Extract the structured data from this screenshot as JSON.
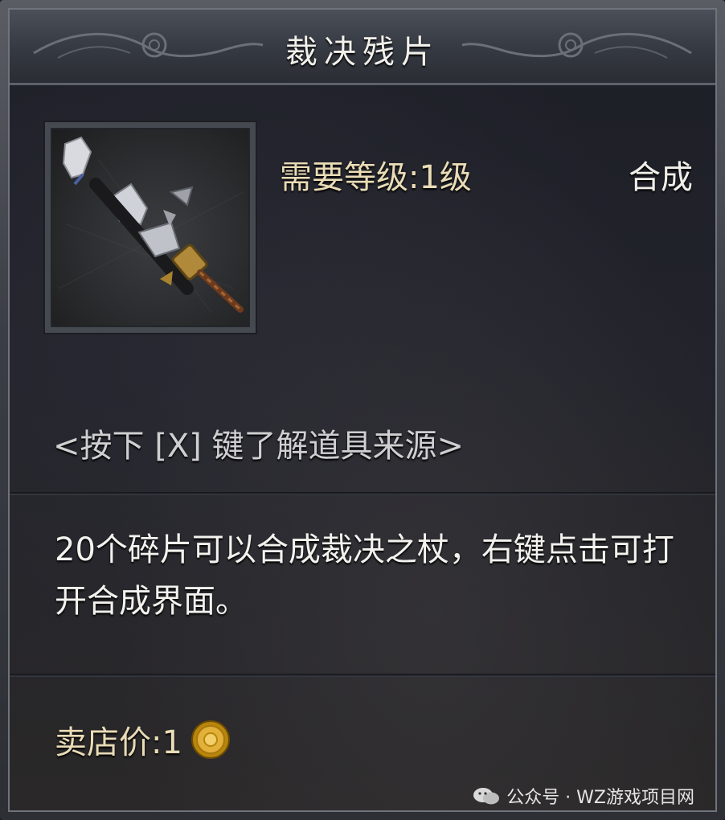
{
  "tooltip": {
    "title": "裁决残片",
    "required_level": "需要等级:1级",
    "item_type": "合成",
    "source_hint": "<按下 [X] 键了解道具来源>",
    "description": "20个碎片可以合成裁决之杖，右键点击可打开合成界面。",
    "sell_price": "卖店价:1",
    "icons": {
      "item": "sword-fragment-icon",
      "currency": "gold-coin-icon"
    }
  },
  "watermark": {
    "text": "公众号 · WZ游戏项目网",
    "icon": "wechat-icon"
  },
  "colors": {
    "title": "#f2f0ea",
    "level": "#e9dcb6",
    "body": "#f3f2ee",
    "hint": "#cfcfd2",
    "panel": "#22232b"
  }
}
